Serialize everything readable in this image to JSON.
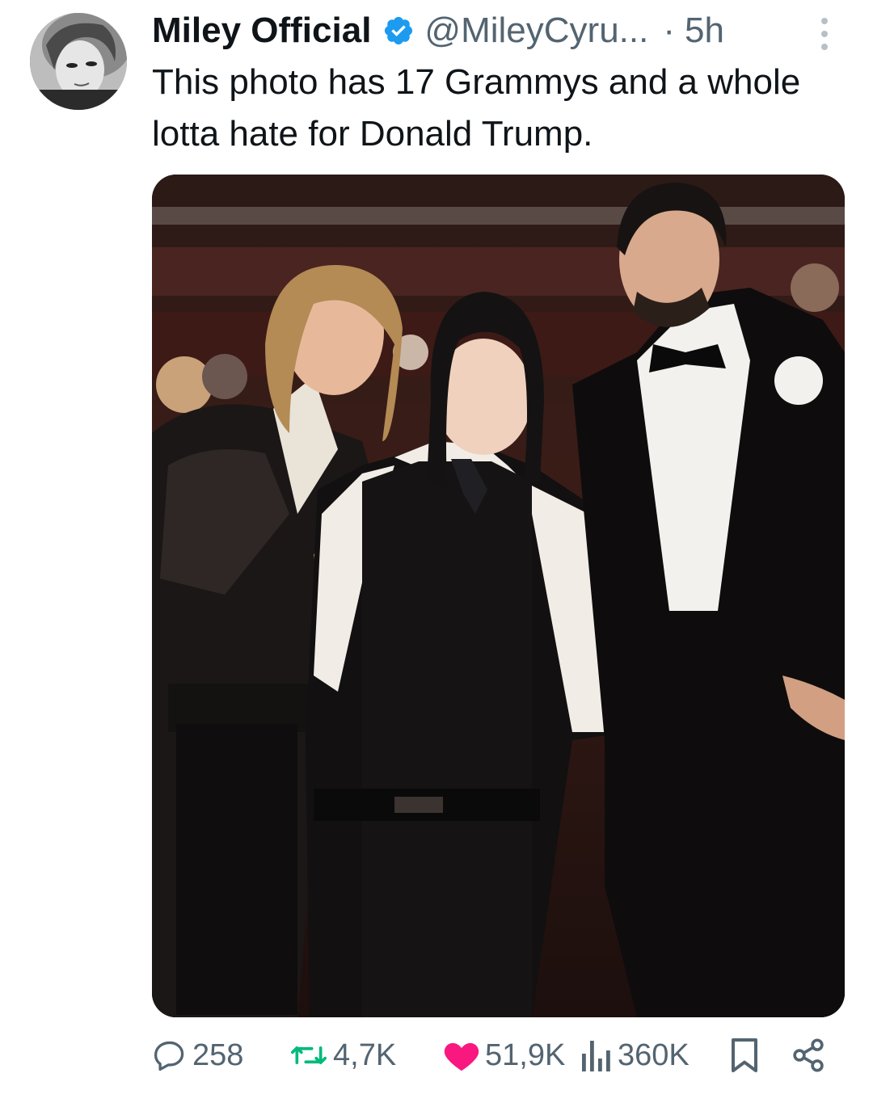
{
  "tweet": {
    "display_name": "Miley Official",
    "handle": "@MileyCyru...",
    "separator": "·",
    "time": "5h",
    "text": "This photo has 17 Grammys and a whole lotta hate for Donald Trump."
  },
  "icons": {
    "verified": "verified-badge-icon",
    "more": "more-vertical-icon",
    "reply": "reply-icon",
    "retweet": "retweet-icon",
    "like": "heart-icon",
    "views": "views-bar-chart-icon",
    "bookmark": "bookmark-icon",
    "share": "share-icon"
  },
  "colors": {
    "verified": "#1d9bf0",
    "retweet": "#00ba7c",
    "like": "#f91880",
    "secondary_text": "#536471",
    "primary_text": "#0f1419"
  },
  "actions": {
    "replies": "258",
    "retweets": "4,7K",
    "likes": "51,9K",
    "views": "360K"
  }
}
